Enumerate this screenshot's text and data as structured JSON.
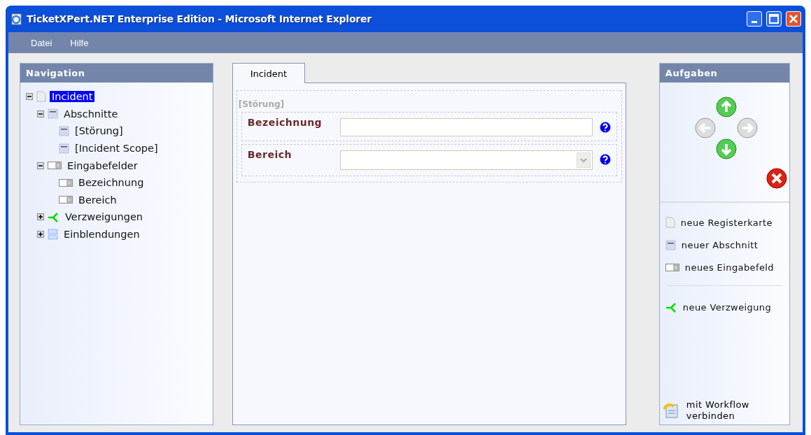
{
  "window": {
    "title": "TicketXPert.NET Enterprise Edition - Microsoft Internet Explorer"
  },
  "menu": [
    {
      "label": "Datei"
    },
    {
      "label": "Hilfe"
    }
  ],
  "navigation": {
    "title": "Navigation",
    "tree": [
      {
        "label": "Incident",
        "kind": "page",
        "selected": true,
        "expanded": true,
        "children": [
          {
            "label": "Abschnitte",
            "kind": "section",
            "selected": false,
            "expanded": true,
            "children": [
              {
                "label": "[Störung]",
                "kind": "section",
                "selected": false
              },
              {
                "label": "[Incident Scope]",
                "kind": "section",
                "selected": false
              }
            ]
          },
          {
            "label": "Eingabefelder",
            "kind": "field",
            "selected": false,
            "expanded": true,
            "children": [
              {
                "label": "Bezeichnung",
                "kind": "field",
                "selected": false
              },
              {
                "label": "Bereich",
                "kind": "field",
                "selected": false
              }
            ]
          },
          {
            "label": "Verzweigungen",
            "kind": "branch",
            "selected": false,
            "expanded": false
          },
          {
            "label": "Einblendungen",
            "kind": "overlay",
            "selected": false,
            "expanded": false
          }
        ]
      }
    ]
  },
  "tabs": [
    {
      "label": "Incident",
      "selected": true
    }
  ],
  "section": {
    "title": "[Störung]",
    "fields": [
      {
        "label": "Bezeichnung",
        "kind": "text"
      },
      {
        "label": "Bereich",
        "kind": "select"
      }
    ]
  },
  "tasks": {
    "title": "Aufgaben",
    "arrows": [
      {
        "kind": "up",
        "disabled": false
      },
      {
        "kind": "left",
        "disabled": true
      },
      {
        "kind": "right",
        "disabled": true
      },
      {
        "kind": "down",
        "disabled": false
      }
    ],
    "groups": [
      [
        {
          "label": "neue Registerkarte",
          "kind": "page"
        },
        {
          "label": "neuer Abschnitt",
          "kind": "section"
        },
        {
          "label": "neues Eingabefeld",
          "kind": "field"
        }
      ],
      [
        {
          "label": "neue Verzweigung",
          "kind": "branch"
        }
      ]
    ],
    "bottom": {
      "label": "mit Workflow verbinden",
      "kind": "workflow"
    }
  }
}
